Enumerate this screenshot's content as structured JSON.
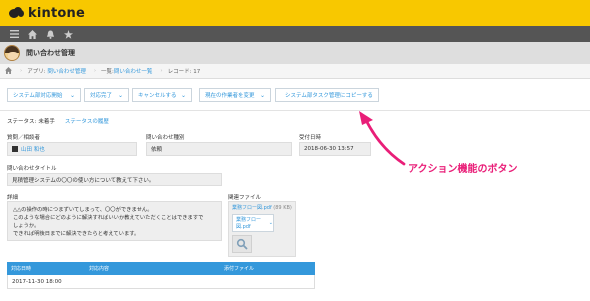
{
  "header": {
    "logo_text": "kintone",
    "brand_color": "#f8c800"
  },
  "toolbar": {
    "icons": [
      "menu-icon",
      "home-icon",
      "bell-icon",
      "star-icon"
    ]
  },
  "app": {
    "title": "問い合わせ管理"
  },
  "breadcrumb": {
    "app_prefix": "アプリ:",
    "app_name": "問い合わせ管理",
    "list_prefix": "一覧:",
    "list_name": "問い合わせ一覧",
    "record": "レコード: 17"
  },
  "actions": [
    {
      "label": "システム部対応開始"
    },
    {
      "label": "対応完了"
    },
    {
      "label": "キャンセルする"
    },
    {
      "label": "現在の作業者を変更"
    },
    {
      "label": "システム部タスク管理にコピーする"
    }
  ],
  "status": {
    "label": "ステータス:",
    "value": "未着手",
    "history_link": "ステータスの履歴"
  },
  "fields": {
    "questioner_label": "質問／相談者",
    "questioner_value": "山田 和也",
    "type_label": "問い合わせ種別",
    "type_value": "依頼",
    "date_label": "受付日時",
    "date_value": "2018-06-30 13:57",
    "title_label": "問い合わせタイトル",
    "title_value": "見積管理システムの〇〇の使い方について教えて下さい。",
    "detail_label": "詳細",
    "detail_value": "△△の操作の時につまずいてしまって、〇〇ができません。\nこのような場合にどのように解決すればいいか教えていただくことはできますで\nしょうか。\nできれば明後日までに解決できたらと考えています。",
    "files_label": "関連ファイル",
    "file_name": "業務フロー図.pdf",
    "file_size": "(89 KB)",
    "file_card_name": "業務フロー図.pdf"
  },
  "annotation": {
    "text": "アクション機能のボタン",
    "color": "#e91e78"
  },
  "table": {
    "headers": [
      "対応日時",
      "対応内容",
      "添付ファイル"
    ],
    "rows": [
      [
        "2017-11-30 18:00",
        "",
        ""
      ]
    ]
  }
}
